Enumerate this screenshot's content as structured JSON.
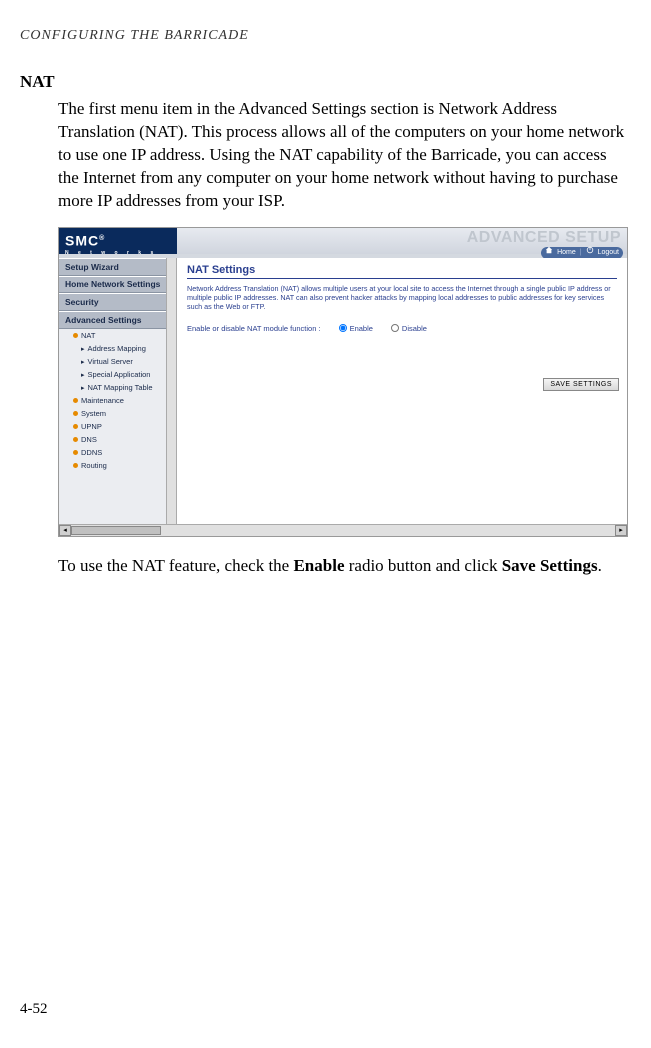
{
  "page_header": "CONFIGURING THE BARRICADE",
  "section_title": "NAT",
  "para1": "The first menu item in the Advanced Settings section is Network Address Translation (NAT). This process allows all of the computers on your home network to use one IP address. Using the NAT capability of the Barricade, you can access the Internet from any computer on your home network without having to purchase more IP addresses from your ISP.",
  "para2_pre": "To use the NAT feature, check the ",
  "para2_b1": "Enable",
  "para2_mid": " radio button and click ",
  "para2_b2": "Save Settings",
  "para2_end": ".",
  "page_number": "4-52",
  "screenshot": {
    "logo": "SMC",
    "logo_reg": "®",
    "logo_sub": "N e t w o r k s",
    "banner": "ADVANCED SETUP",
    "topnav_home": "Home",
    "topnav_logout": "Logout",
    "sidebar": {
      "setup_wizard": "Setup Wizard",
      "home_network": "Home Network Settings",
      "security": "Security",
      "advanced_settings": "Advanced Settings",
      "nat": "NAT",
      "address_mapping": "Address Mapping",
      "virtual_server": "Virtual Server",
      "special_application": "Special Application",
      "nat_mapping_table": "NAT Mapping Table",
      "maintenance": "Maintenance",
      "system": "System",
      "upnp": "UPNP",
      "dns": "DNS",
      "ddns": "DDNS",
      "routing": "Routing"
    },
    "main": {
      "title": "NAT Settings",
      "desc": "Network Address Translation (NAT) allows multiple users at your local site to access the Internet through a single public IP address or multiple public IP addresses. NAT can also prevent hacker attacks by mapping local addresses to public addresses for key services such as the Web or FTP.",
      "option_label": "Enable or disable NAT module function :",
      "enable": "Enable",
      "disable": "Disable",
      "save_button": "SAVE SETTINGS"
    }
  }
}
